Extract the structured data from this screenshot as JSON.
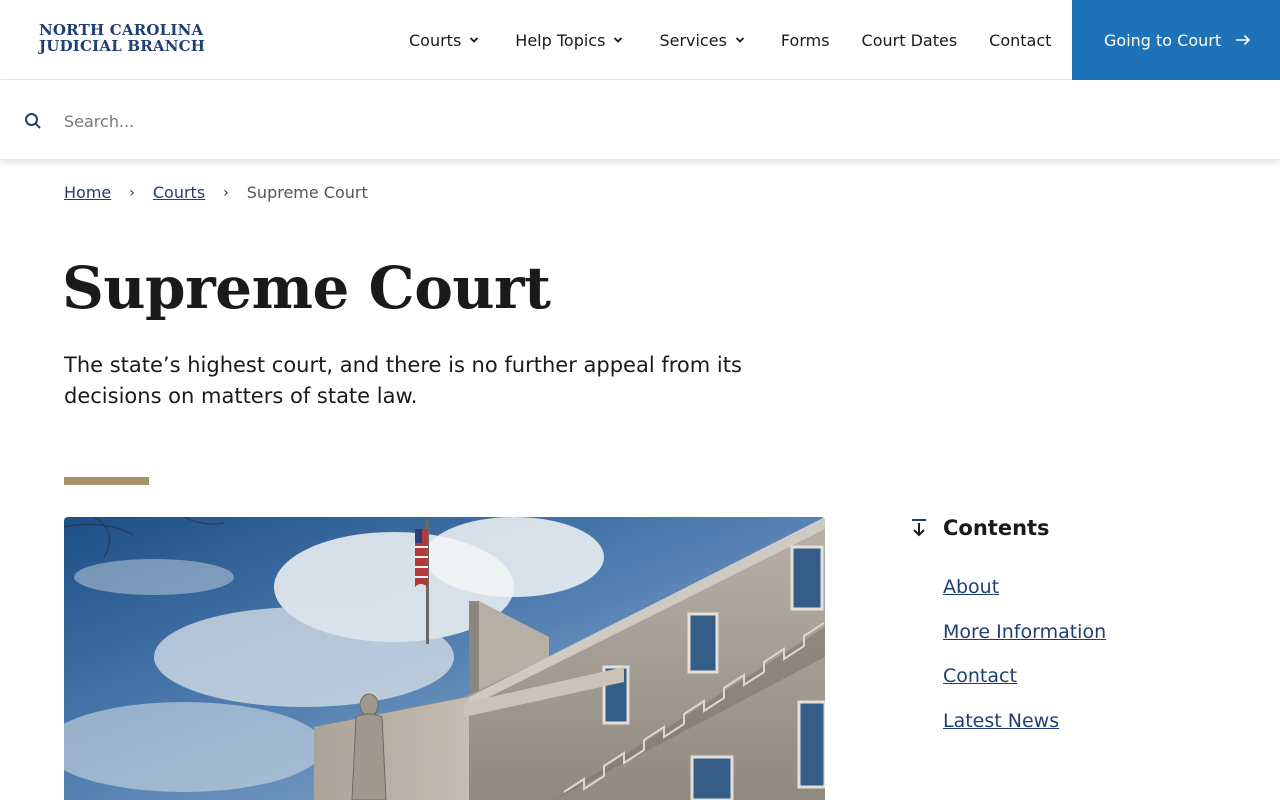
{
  "header": {
    "logo_line1": "NORTH CAROLINA",
    "logo_line2": "JUDICIAL BRANCH",
    "nav": [
      {
        "label": "Courts",
        "dropdown": true
      },
      {
        "label": "Help Topics",
        "dropdown": true
      },
      {
        "label": "Services",
        "dropdown": true
      },
      {
        "label": "Forms",
        "dropdown": false
      },
      {
        "label": "Court Dates",
        "dropdown": false
      },
      {
        "label": "Contact",
        "dropdown": false
      }
    ],
    "cta_label": "Going to Court",
    "cta_color": "#1e73b8"
  },
  "search": {
    "placeholder": "Search...",
    "value": ""
  },
  "breadcrumb": {
    "home": "Home",
    "courts": "Courts",
    "current": "Supreme Court"
  },
  "page": {
    "title": "Supreme Court",
    "lede": "The state’s highest court, and there is no further appeal from its decisions on matters of state law.",
    "accent_color": "#a8916b"
  },
  "contents": {
    "title": "Contents",
    "items": [
      "About",
      "More Information",
      "Contact",
      "Latest News"
    ]
  },
  "icons": {
    "search": "search-icon",
    "chevron": "chevron-down-icon",
    "arrow": "arrow-right-icon",
    "contents": "arrow-down-to-line-icon"
  },
  "colors": {
    "link": "#1f3f73",
    "brand": "#1f3f73"
  }
}
